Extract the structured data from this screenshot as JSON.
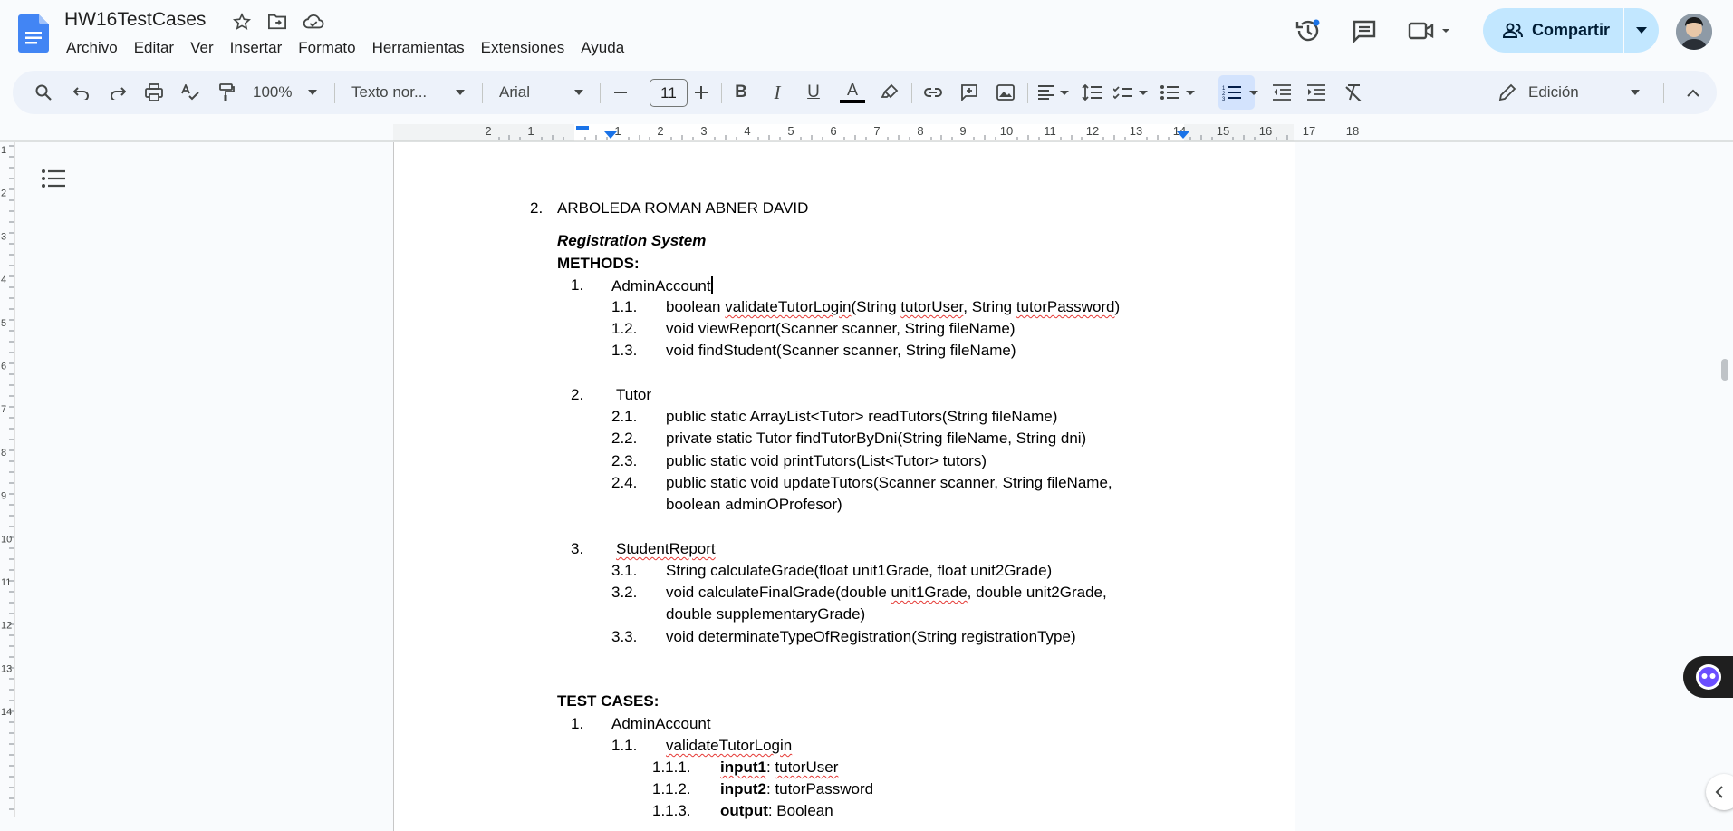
{
  "doc_title": "HW16TestCases",
  "menu": [
    "Archivo",
    "Editar",
    "Ver",
    "Insertar",
    "Formato",
    "Herramientas",
    "Extensiones",
    "Ayuda"
  ],
  "share_label": "Compartir",
  "toolbar": {
    "zoom": "100%",
    "style": "Texto nor...",
    "font": "Arial",
    "font_size": "11",
    "mode": "Edición"
  },
  "ruler_labels": [
    "2",
    "1",
    "1",
    "2",
    "3",
    "4",
    "5",
    "6",
    "7",
    "8",
    "9",
    "10",
    "11",
    "12",
    "13",
    "14",
    "15",
    "16",
    "17",
    "18"
  ],
  "vruler_labels": [
    "1",
    "2",
    "3",
    "4",
    "5",
    "6",
    "7",
    "8",
    "9",
    "10",
    "11",
    "12",
    "13",
    "14"
  ],
  "document": {
    "author_num": "2.",
    "author": "ARBOLEDA ROMAN ABNER DAVID",
    "system_title": "Registration System",
    "methods_heading": "METHODS:",
    "m1_num": "1.",
    "m1": "AdminAccount",
    "m1_1_num": "1.1.",
    "m1_1_a": "boolean ",
    "m1_1_b": "validateTutorLogin",
    "m1_1_c": "(String ",
    "m1_1_d": "tutorUser",
    "m1_1_e": ", String ",
    "m1_1_f": "tutorPassword",
    "m1_1_g": ")",
    "m1_2_num": "1.2.",
    "m1_2": "void viewReport(Scanner scanner, String fileName)",
    "m1_3_num": "1.3.",
    "m1_3": "void findStudent(Scanner scanner, String fileName)",
    "m2_num": "2.",
    "m2": "Tutor",
    "m2_1_num": "2.1.",
    "m2_1": "public static ArrayList<Tutor> readTutors(String fileName)",
    "m2_2_num": "2.2.",
    "m2_2": "private static Tutor findTutorByDni(String fileName, String dni)",
    "m2_3_num": "2.3.",
    "m2_3": "public static void printTutors(List<Tutor> tutors)",
    "m2_4_num": "2.4.",
    "m2_4_l1": "public static void updateTutors(Scanner scanner, String fileName,",
    "m2_4_l2": "boolean adminOProfesor)",
    "m3_num": "3.",
    "m3": "StudentReport",
    "m3_1_num": "3.1.",
    "m3_1": "String calculateGrade(float unit1Grade, float unit2Grade)",
    "m3_2_num": "3.2.",
    "m3_2_a": "void calculateFinalGrade(double ",
    "m3_2_b": "unit1Grade",
    "m3_2_c": ", double unit2Grade,",
    "m3_2_l2": "double supplementaryGrade)",
    "m3_3_num": "3.3.",
    "m3_3": "void determinateTypeOfRegistration(String registrationType)",
    "tests_heading": "TEST CASES:",
    "t1_num": "1.",
    "t1": "AdminAccount",
    "t1_1_num": "1.1.",
    "t1_1": "validateTutorLogin",
    "t1_1_1_num": "1.1.1.",
    "t1_1_1_label": "input1",
    "t1_1_1_sep": ": ",
    "t1_1_1_val": "tutorUser",
    "t1_1_2_num": "1.1.2.",
    "t1_1_2_label": "input2",
    "t1_1_2_val": ": tutorPassword",
    "t1_1_3_num": "1.1.3.",
    "t1_1_3_label": "output",
    "t1_1_3_val": ": Boolean"
  },
  "colors": {
    "doc_blue": "#4285f4",
    "share_bg": "#c2e7ff",
    "toolbar_bg": "#edf2fa",
    "active_bg": "#d3e3fd",
    "spell_red": "#e53935"
  }
}
